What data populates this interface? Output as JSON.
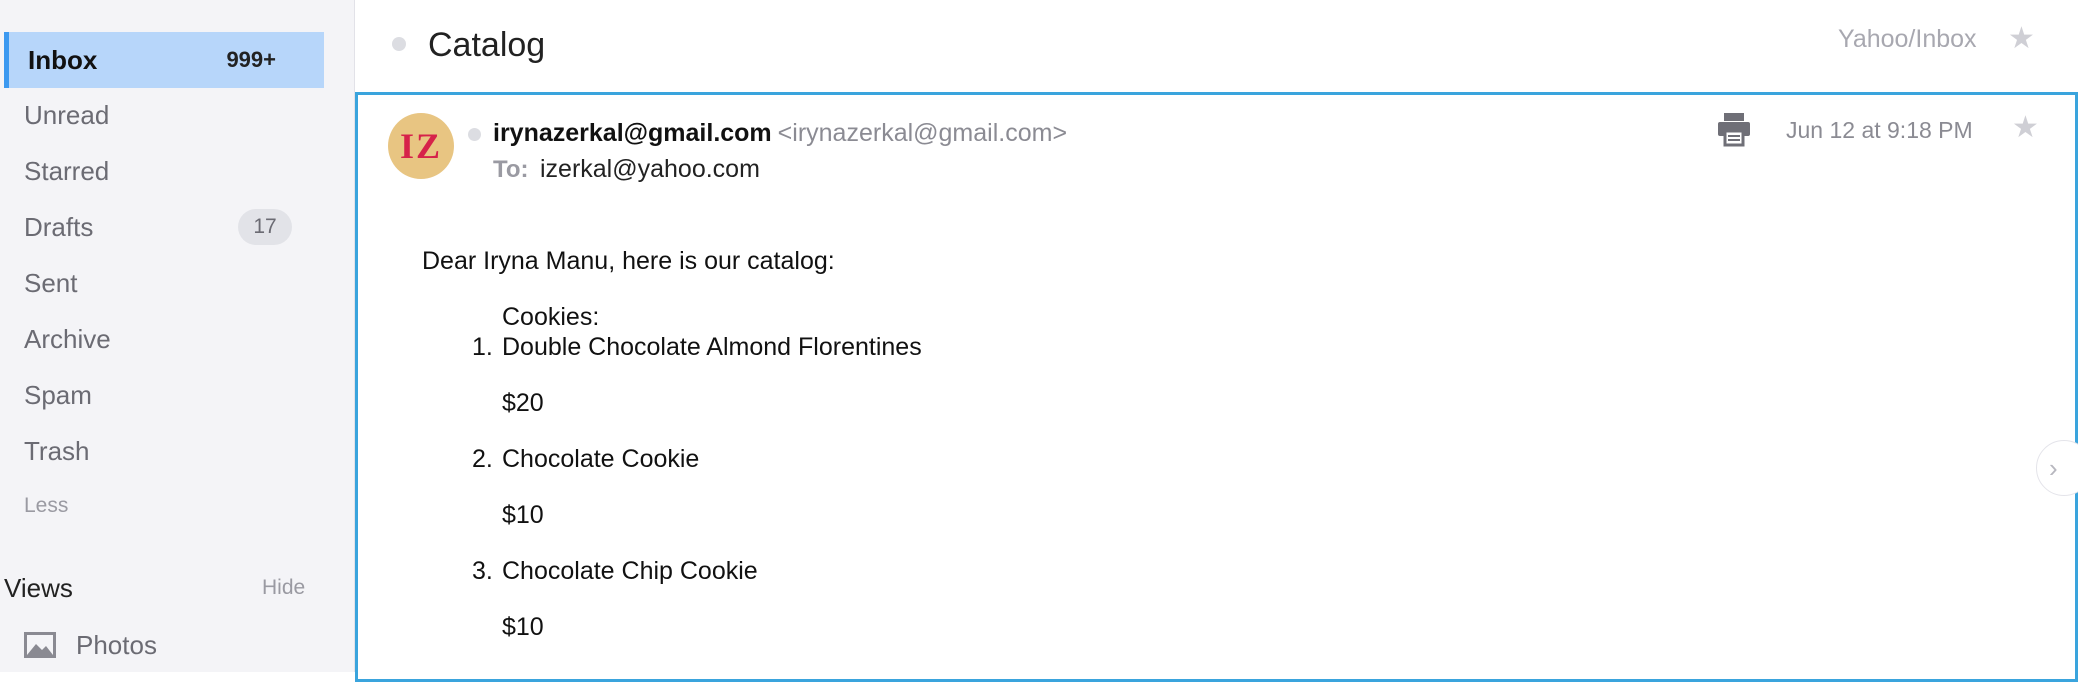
{
  "sidebar": {
    "items": [
      {
        "label": "Inbox",
        "count": "999+"
      },
      {
        "label": "Unread"
      },
      {
        "label": "Starred"
      },
      {
        "label": "Drafts",
        "count": "17"
      },
      {
        "label": "Sent"
      },
      {
        "label": "Archive"
      },
      {
        "label": "Spam"
      },
      {
        "label": "Trash"
      }
    ],
    "less_label": "Less",
    "views_title": "Views",
    "hide_label": "Hide",
    "photos_label": "Photos"
  },
  "header": {
    "subject": "Catalog",
    "folder_path": "Yahoo/Inbox"
  },
  "message": {
    "avatar_initials": "IZ",
    "sender_name": "irynazerkal@gmail.com",
    "sender_email": "<irynazerkal@gmail.com>",
    "to_label": "To:",
    "to_value": "izerkal@yahoo.com",
    "date": "Jun 12 at 9:18 PM",
    "body": {
      "greeting": "Dear Iryna Manu, here is our catalog:",
      "section_title": "Cookies:",
      "items": [
        {
          "num": "1.",
          "name": "Double Chocolate Almond Florentines",
          "price": "$20"
        },
        {
          "num": "2.",
          "name": "Chocolate Cookie",
          "price": "$10"
        },
        {
          "num": "3.",
          "name": "Chocolate Chip Cookie",
          "price": "$10"
        }
      ]
    }
  },
  "colors": {
    "accent": "#3aa4dd",
    "selected_bg": "#b7d6fa",
    "avatar_bg": "#e8c582",
    "avatar_fg": "#d6224a"
  },
  "icons": {
    "print": "print-icon",
    "star": "star-icon",
    "photos": "photos-icon",
    "next": "chevron-right-icon"
  }
}
